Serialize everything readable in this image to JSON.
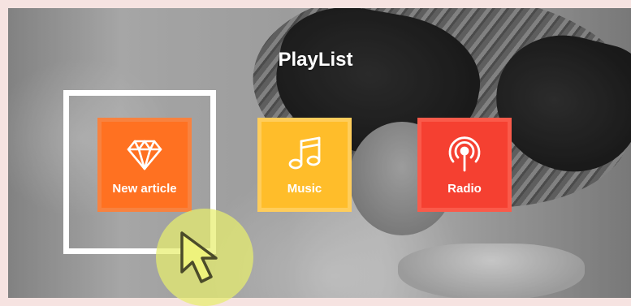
{
  "playlist": {
    "title": "PlayList",
    "tiles": [
      {
        "label": "New article",
        "icon": "diamond-icon",
        "color": "#ff7121"
      },
      {
        "label": "Music",
        "icon": "music-note-icon",
        "color": "#ffbd2a"
      },
      {
        "label": "Radio",
        "icon": "radio-broadcast-icon",
        "color": "#f54031"
      }
    ]
  },
  "overlay": {
    "highlight_color": "#ffffff",
    "cursor_glow_color": "#e8ee6e"
  }
}
